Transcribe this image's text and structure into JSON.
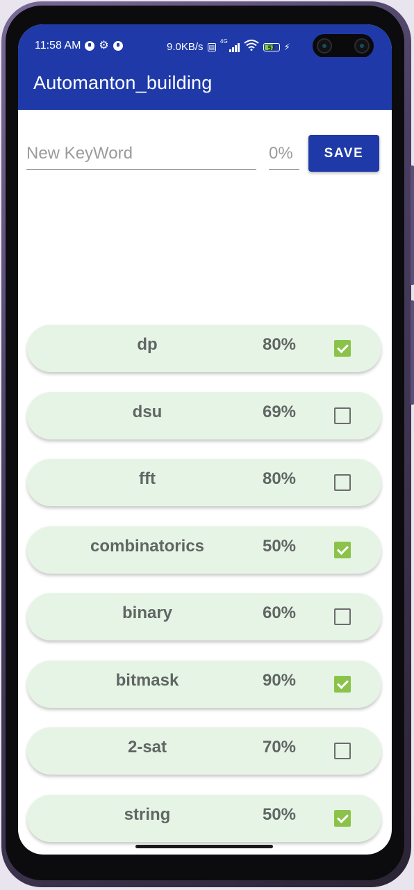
{
  "status_bar": {
    "time": "11:58 AM",
    "network_speed": "9.0KB/s",
    "network_type": "4G",
    "battery_level": "57",
    "icons": [
      "data-saver-icon",
      "settings-gear-icon",
      "data-saver-icon",
      "volte-icon",
      "signal-icon",
      "wifi-icon",
      "battery-icon",
      "charging-bolt-icon"
    ]
  },
  "app_bar": {
    "title": "Automanton_building",
    "color": "#1f3aa8"
  },
  "form": {
    "keyword_placeholder": "New KeyWord",
    "keyword_value": "",
    "percent_placeholder": "0%",
    "percent_value": "",
    "save_label": "SAVE"
  },
  "items": [
    {
      "name": "dp",
      "percent": "80%",
      "checked": true
    },
    {
      "name": "dsu",
      "percent": "69%",
      "checked": false
    },
    {
      "name": "fft",
      "percent": "80%",
      "checked": false
    },
    {
      "name": "combinatorics",
      "percent": "50%",
      "checked": true
    },
    {
      "name": "binary",
      "percent": "60%",
      "checked": false
    },
    {
      "name": "bitmask",
      "percent": "90%",
      "checked": true
    },
    {
      "name": "2-sat",
      "percent": "70%",
      "checked": false
    },
    {
      "name": "string",
      "percent": "50%",
      "checked": true
    }
  ],
  "colors": {
    "accent": "#1f3aa8",
    "item_background": "#e6f4e6",
    "checkbox_checked": "#8bc34a"
  }
}
